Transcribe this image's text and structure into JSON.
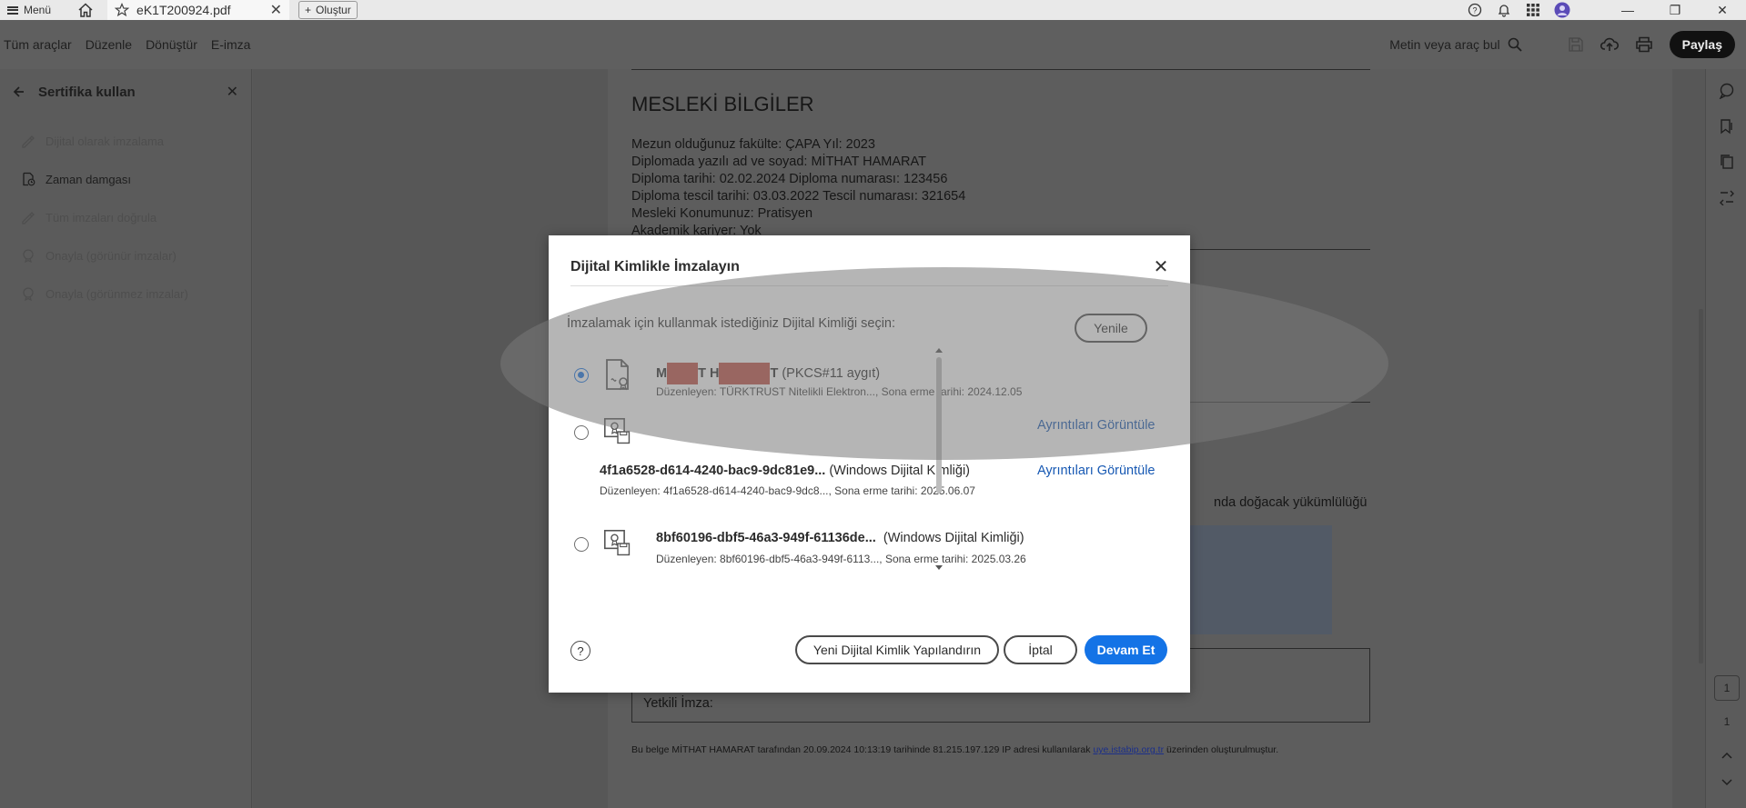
{
  "titlebar": {
    "menu_label": "Menü",
    "tab_name": "eK1T200924.pdf",
    "create_label": "Oluştur"
  },
  "toolbar": {
    "items": [
      "Tüm araçlar",
      "Düzenle",
      "Dönüştür",
      "E-imza"
    ],
    "search_label": "Metin veya araç bul",
    "share_label": "Paylaş"
  },
  "left_panel": {
    "title": "Sertifika kullan",
    "items": [
      {
        "label": "Dijital olarak imzalama",
        "enabled": false
      },
      {
        "label": "Zaman damgası",
        "enabled": true
      },
      {
        "label": "Tüm imzaları doğrula",
        "enabled": false
      },
      {
        "label": "Onayla (görünür imzalar)",
        "enabled": false
      },
      {
        "label": "Onayla (görünmez imzalar)",
        "enabled": false
      }
    ]
  },
  "document": {
    "heading": "MESLEKİ BİLGİLER",
    "lines": [
      "Mezun olduğunuz fakülte: ÇAPA   Yıl: 2023",
      "Diplomada yazılı ad ve soyad: MİTHAT HAMARAT",
      "Diploma tarihi: 02.02.2024    Diploma numarası: 123456",
      "Diploma tescil tarihi: 03.03.2022    Tescil numarası: 321654",
      "Mesleki Konumunuz: Pratisyen",
      "Akademik kariyer: Yok"
    ],
    "partial_text": "nda doğacak yükümlülüğü",
    "signature_label": "Yetkili İmza:",
    "footer_pre": "Bu belge MİTHAT HAMARAT tarafından 20.09.2024 10:13:19 tarihinde 81.215.197.129 IP adresi kullanılarak ",
    "footer_link": "uye.istabip.org.tr",
    "footer_post": " üzerinden oluşturulmuştur."
  },
  "right_rail": {
    "page_current": "1",
    "page_total": "1"
  },
  "dialog": {
    "title": "Dijital Kimlikle İmzalayın",
    "prompt": "İmzalamak için kullanmak istediğiniz Dijital Kimliği seçin:",
    "refresh_label": "Yenile",
    "ids": [
      {
        "name_start": "M",
        "name_mid": "T H",
        "name_end": "T",
        "type": "(PKCS#11 aygıt)",
        "details": "Düzenleyen: TÜRKTRUST Nitelikli Elektron..., Sona erme tarihi: 2024.12.05",
        "selected": true
      },
      {
        "name": "",
        "type": "",
        "details": "",
        "link": "Ayrıntıları Görüntüle",
        "selected": false
      },
      {
        "name": "4f1a6528-d614-4240-bac9-9dc81e9...",
        "type": "(Windows Dijital Kimliği)",
        "details": "Düzenleyen: 4f1a6528-d614-4240-bac9-9dc8..., Sona erme tarihi: 2025.06.07",
        "link": "Ayrıntıları Görüntüle"
      },
      {
        "name": "8bf60196-dbf5-46a3-949f-61136de...",
        "type": "(Windows Dijital Kimliği)",
        "details": "Düzenleyen: 8bf60196-dbf5-46a3-949f-6113..., Sona erme tarihi: 2025.03.26",
        "selected": false
      }
    ],
    "help_symbol": "?",
    "configure_label": "Yeni Dijital Kimlik Yapılandırın",
    "cancel_label": "İptal",
    "continue_label": "Devam Et"
  },
  "colors": {
    "accent": "#1473e6",
    "link": "#1658b3",
    "redaction": "#c25145"
  }
}
